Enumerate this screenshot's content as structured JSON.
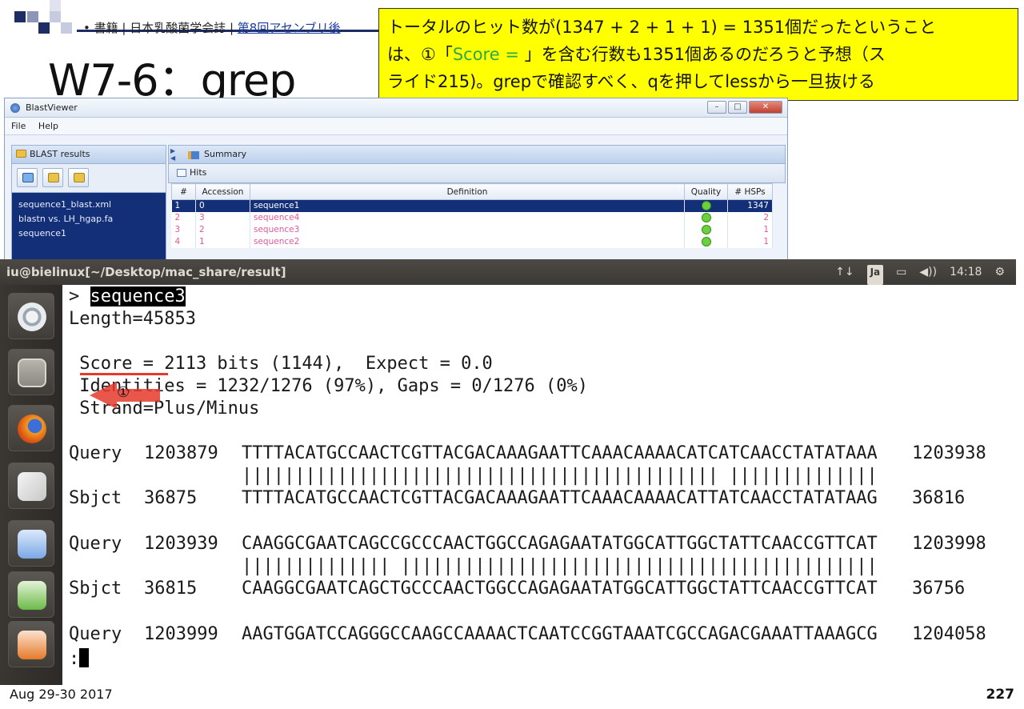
{
  "slide": {
    "breadcrumb_prefix": "• 書籍 | 日本乳酸菌学会誌 | ",
    "breadcrumb_link": "第8回アセンブリ後",
    "title": "W7-6：grep",
    "callout_line1": "トータルのヒット数が(1347 + 2 + 1 + 1) = 1351個だったということ",
    "callout_line2_a": "は、①「",
    "callout_line2_score": "Score = ",
    "callout_line2_b": "」を含む行数も1351個あるのだろうと予想（ス",
    "callout_line3": "ライド215)。grepで確認すべく、qを押してlessから一旦抜ける",
    "date": "Aug 29-30 2017",
    "page_number": "227",
    "arrow_label": "①",
    "accent_color": "#ffff00",
    "arrow_color": "#e53a2a"
  },
  "blast_viewer": {
    "window_title": "BlastViewer",
    "menu": [
      "File",
      "Help"
    ],
    "left_panel_title": "BLAST results",
    "files": [
      "sequence1_blast.xml",
      "blastn vs. LH_hgap.fa",
      "sequence1"
    ],
    "summary_label": "Summary",
    "hits_label": "Hits",
    "columns": [
      "#",
      "Accession",
      "Definition",
      "Quality",
      "# HSPs"
    ],
    "rows": [
      {
        "n": "1",
        "acc": "0",
        "def": "sequence1",
        "hsps": "1347",
        "selected": true
      },
      {
        "n": "2",
        "acc": "3",
        "def": "sequence4",
        "hsps": "2",
        "selected": false
      },
      {
        "n": "3",
        "acc": "2",
        "def": "sequence3",
        "hsps": "1",
        "selected": false
      },
      {
        "n": "4",
        "acc": "1",
        "def": "sequence2",
        "hsps": "1",
        "selected": false
      }
    ]
  },
  "topbar": {
    "window_path": "iu@bielinux[~/Desktop/mac_share/result]",
    "network_icon": "↑↓",
    "ime": "Ja",
    "battery_icon": "battery-icon",
    "volume": "◀))",
    "time": "14:18",
    "settings_icon": "⚙"
  },
  "terminal": {
    "lines": [
      {
        "prefix": "> ",
        "highlight": "sequence3",
        "rest": ""
      },
      {
        "prefix": "Length=45853",
        "highlight": "",
        "rest": ""
      },
      {
        "prefix": "",
        "highlight": "",
        "rest": ""
      },
      {
        "prefix": " Score = 2113 bits (1144),  Expect = 0.0",
        "highlight": "",
        "rest": ""
      },
      {
        "prefix": " Identities = 1232/1276 (97%), Gaps = 0/1276 (0%)",
        "highlight": "",
        "rest": ""
      },
      {
        "prefix": " Strand=Plus/Minus",
        "highlight": "",
        "rest": ""
      }
    ],
    "alignments": [
      {
        "label": "Query",
        "start": "1203879",
        "seq": "TTTTACATGCCAACTCGTTACGACAAAGAATTCAAACAAAACATCATCAACCTATATAAA",
        "end": "1203938"
      },
      {
        "label": "",
        "start": "",
        "seq": "||||||||||||||||||||||||||||||||||||||||||||| ||||||||||||||",
        "end": ""
      },
      {
        "label": "Sbjct",
        "start": "36875",
        "seq": "TTTTACATGCCAACTCGTTACGACAAAGAATTCAAACAAAACATTATCAACCTATATAAG",
        "end": "36816"
      },
      {
        "label": "Query",
        "start": "1203939",
        "seq": "CAAGGCGAATCAGCCGCCCAACTGGCCAGAGAATATGGCATTGGCTATTCAACCGTTCAT",
        "end": "1203998"
      },
      {
        "label": "",
        "start": "",
        "seq": "|||||||||||||| |||||||||||||||||||||||||||||||||||||||||||||",
        "end": ""
      },
      {
        "label": "Sbjct",
        "start": "36815",
        "seq": "CAAGGCGAATCAGCTGCCCAACTGGCCAGAGAATATGGCATTGGCTATTCAACCGTTCAT",
        "end": "36756"
      },
      {
        "label": "Query",
        "start": "1203999",
        "seq": "AAGTGGATCCAGGGCCAAGCCAAAACTCAATCCGGTAAATCGCCAGACGAAATTAAAGCG",
        "end": "1204058"
      }
    ],
    "prompt": ":"
  }
}
